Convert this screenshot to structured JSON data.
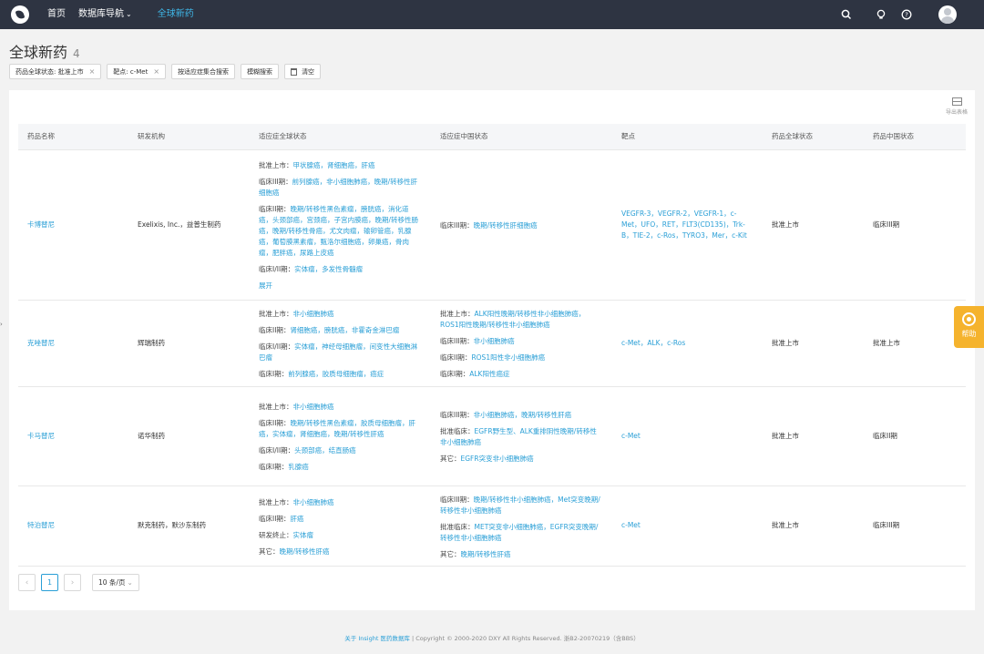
{
  "nav": {
    "home": "首页",
    "db_nav": "数据库导航",
    "current": "全球新药"
  },
  "page": {
    "title": "全球新药",
    "count": "4"
  },
  "filters": {
    "chip1": "药品全球状态: 批准上市",
    "chip2": "靶点: c-Met",
    "by_indication": "按适应症集合搜索",
    "fuzzy": "模糊搜索",
    "clear": "清空",
    "close_glyph": "×"
  },
  "table": {
    "export_label": "导出表格",
    "headers": [
      "药品名称",
      "研发机构",
      "适应症全球状态",
      "适应症中国状态",
      "靶点",
      "药品全球状态",
      "药品中国状态"
    ],
    "rows": [
      {
        "name": "卡博替尼",
        "org": "Exelixis, Inc.，益普生制药",
        "global": [
          {
            "label": "批准上市：",
            "value": "甲状腺癌，肾细胞癌，肝癌"
          },
          {
            "label": "临床III期：",
            "value": "前列腺癌，非小细胞肺癌，晚期/转移性肝细胞癌"
          },
          {
            "label": "临床II期：",
            "value": "晚期/转移性黑色素瘤，膀胱癌，消化道癌，头颈部癌，宫颈癌，子宫内膜癌，晚期/转移性肠癌，晚期/转移性骨癌，尤文肉瘤，输卵管癌，乳腺癌，葡萄膜黑素瘤，甄洛尔细胞癌，卵巢癌，骨肉瘤，肥胖癌，尿路上皮癌"
          },
          {
            "label": "临床I/II期：",
            "value": "实体瘤，多发性骨髓瘤"
          }
        ],
        "expand": "展开",
        "china": [
          {
            "label": "临床III期：",
            "value": "晚期/转移性肝细胞癌"
          }
        ],
        "targets": "VEGFR-3，VEGFR-2，VEGFR-1，c-Met，UFO，RET，FLT3(CD135)，Trk-B，TIE-2，c-Ros，TYRO3，Mer，c-Kit",
        "global_status": "批准上市",
        "china_status": "临床III期"
      },
      {
        "name": "克唑替尼",
        "org": "辉瑞制药",
        "global": [
          {
            "label": "批准上市：",
            "value": "非小细胞肺癌"
          },
          {
            "label": "临床II期：",
            "value": "肾细胞癌，膀胱癌，非霍奇金淋巴瘤"
          },
          {
            "label": "临床I/II期：",
            "value": "实体瘤，神经母细胞瘤，间变性大细胞淋巴瘤"
          },
          {
            "label": "临床I期：",
            "value": "前列腺癌，胶质母细胞瘤，癌症"
          }
        ],
        "china": [
          {
            "label": "批准上市：",
            "value": "ALK阳性晚期/转移性非小细胞肺癌，ROS1阳性晚期/转移性非小细胞肺癌"
          },
          {
            "label": "临床III期：",
            "value": "非小细胞肺癌"
          },
          {
            "label": "临床II期：",
            "value": "ROS1阳性非小细胞肺癌"
          },
          {
            "label": "临床I期：",
            "value": "ALK阳性癌症"
          }
        ],
        "targets": "c-Met，ALK，c-Ros",
        "global_status": "批准上市",
        "china_status": "批准上市"
      },
      {
        "name": "卡马替尼",
        "org": "诺华制药",
        "global": [
          {
            "label": "批准上市：",
            "value": "非小细胞肺癌"
          },
          {
            "label": "临床II期：",
            "value": "晚期/转移性黑色素瘤，胶质母细胞瘤，肝癌，实体瘤，肾细胞癌，晚期/转移性肝癌"
          },
          {
            "label": "临床I/II期：",
            "value": "头颈部癌，结直肠癌"
          },
          {
            "label": "临床I期：",
            "value": "乳腺癌"
          }
        ],
        "china": [
          {
            "label": "临床III期：",
            "value": "非小细胞肺癌，晚期/转移性肝癌"
          },
          {
            "label": "批准临床：",
            "value": "EGFR野生型、ALK重排阴性晚期/转移性非小细胞肺癌"
          },
          {
            "label": "其它：",
            "value": "EGFR突变非小细胞肺癌"
          }
        ],
        "targets": "c-Met",
        "global_status": "批准上市",
        "china_status": "临床II期"
      },
      {
        "name": "特泊替尼",
        "org": "默克制药，默沙东制药",
        "global": [
          {
            "label": "批准上市：",
            "value": "非小细胞肺癌"
          },
          {
            "label": "临床II期：",
            "value": "肝癌"
          },
          {
            "label": "研发终止：",
            "value": "实体瘤"
          },
          {
            "label": "其它：",
            "value": "晚期/转移性肝癌"
          }
        ],
        "china": [
          {
            "label": "临床III期：",
            "value": "晚期/转移性非小细胞肺癌，Met突变晚期/转移性非小细胞肺癌"
          },
          {
            "label": "批准临床：",
            "value": "MET突变非小细胞肺癌，EGFR突变晚期/转移性非小细胞肺癌"
          },
          {
            "label": "其它：",
            "value": "晚期/转移性肝癌"
          }
        ],
        "targets": "c-Met",
        "global_status": "批准上市",
        "china_status": "临床III期"
      }
    ]
  },
  "pager": {
    "prev": "‹",
    "current": "1",
    "next": "›",
    "page_size": "10 条/页"
  },
  "footer": {
    "link": "关于 Insight 医药数据库",
    "text": "| Copyright © 2000-2020 DXY All Rights Reserved. 浙B2-20070219（含BBS）"
  },
  "help": {
    "label": "帮助"
  },
  "colors": {
    "topbar": "#2e3442",
    "accent": "#2a9fd6",
    "help": "#f5b32d"
  }
}
